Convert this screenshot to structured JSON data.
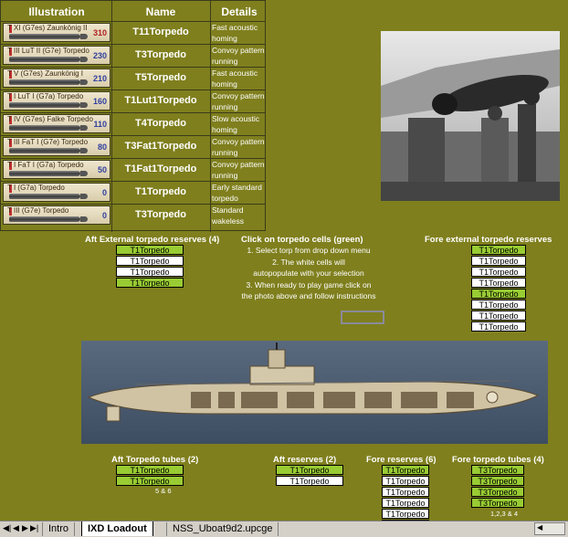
{
  "table": {
    "headers": [
      "Illustration",
      "Name",
      "Details"
    ],
    "rows": [
      {
        "illus_label": "T XI (G7es) Zaunkönig II",
        "illus_num": "310",
        "num_red": true,
        "name": "T11Torpedo",
        "detail": "Fast acoustic homing"
      },
      {
        "illus_label": "T III LuT II (G7e) Torpedo",
        "illus_num": "230",
        "num_red": false,
        "name": "T3Torpedo",
        "detail": "Convoy pattern running"
      },
      {
        "illus_label": "T V (G7es) Zaunkönig I",
        "illus_num": "210",
        "num_red": false,
        "name": "T5Torpedo",
        "detail": "Fast acoustic homing"
      },
      {
        "illus_label": "T I LuT I (G7a) Torpedo",
        "illus_num": "160",
        "num_red": false,
        "name": "T1Lut1Torpedo",
        "detail": "Convoy pattern running"
      },
      {
        "illus_label": "T IV (G7es) Falke Torpedo",
        "illus_num": "110",
        "num_red": false,
        "name": "T4Torpedo",
        "detail": "Slow acoustic homing"
      },
      {
        "illus_label": "T III FaT I (G7e) Torpedo",
        "illus_num": "80",
        "num_red": false,
        "name": "T3Fat1Torpedo",
        "detail": "Convoy pattern running"
      },
      {
        "illus_label": "T I FaT I (G7a) Torpedo",
        "illus_num": "50",
        "num_red": false,
        "name": "T1Fat1Torpedo",
        "detail": "Convoy pattern running"
      },
      {
        "illus_label": "T I (G7a) Torpedo",
        "illus_num": "0",
        "num_red": false,
        "name": "T1Torpedo",
        "detail": "Early standard torpedo"
      },
      {
        "illus_label": "T III (G7e) Torpedo",
        "illus_num": "0",
        "num_red": false,
        "name": "T3Torpedo",
        "detail": "Standard wakeless"
      }
    ]
  },
  "aft_external": {
    "title": "Aft External torpedo reserves (4)",
    "cells": [
      {
        "value": "T1Torpedo",
        "green": true
      },
      {
        "value": "T1Torpedo",
        "green": false
      },
      {
        "value": "T1Torpedo",
        "green": false
      },
      {
        "value": "T1Torpedo",
        "green": true
      }
    ]
  },
  "instructions": {
    "title": "Click on torpedo cells (green)",
    "lines": [
      "1. Select torp from drop down menu",
      "2. The white cells will",
      "autopopulate with your selection",
      "3. When ready to play game click on",
      "the photo above and follow instructions"
    ]
  },
  "fore_external": {
    "title": "Fore external torpedo reserves",
    "cells": [
      {
        "value": "T1Torpedo",
        "green": true
      },
      {
        "value": "T1Torpedo",
        "green": false
      },
      {
        "value": "T1Torpedo",
        "green": false
      },
      {
        "value": "T1Torpedo",
        "green": false
      },
      {
        "value": "T1Torpedo",
        "green": true
      },
      {
        "value": "T1Torpedo",
        "green": false
      },
      {
        "value": "T1Torpedo",
        "green": false
      },
      {
        "value": "T1Torpedo",
        "green": false
      }
    ]
  },
  "aft_tubes": {
    "title": "Aft Torpedo tubes (2)",
    "cells": [
      {
        "value": "T1Torpedo",
        "green": true
      },
      {
        "value": "T1Torpedo",
        "green": true
      }
    ],
    "note": "5 & 6"
  },
  "aft_reserves": {
    "title": "Aft reserves (2)",
    "cells": [
      {
        "value": "T1Torpedo",
        "green": true
      },
      {
        "value": "T1Torpedo",
        "green": false
      }
    ]
  },
  "fore_reserves": {
    "title": "Fore reserves (6)",
    "cells": [
      {
        "value": "T1Torpedo",
        "green": true
      },
      {
        "value": "T1Torpedo",
        "green": false
      },
      {
        "value": "T1Torpedo",
        "green": false
      },
      {
        "value": "T1Torpedo",
        "green": false
      },
      {
        "value": "T1Torpedo",
        "green": false
      },
      {
        "value": "T1Torpedo",
        "green": false
      }
    ]
  },
  "fore_tubes": {
    "title": "Fore torpedo tubes (4)",
    "cells": [
      {
        "value": "T3Torpedo",
        "green": true
      },
      {
        "value": "T3Torpedo",
        "green": true
      },
      {
        "value": "T3Torpedo",
        "green": true
      },
      {
        "value": "T3Torpedo",
        "green": true
      }
    ],
    "note": "1,2,3 & 4"
  },
  "sheet_tabs": {
    "tabs": [
      "Intro",
      "IXD Loadout",
      "NSS_Uboat9d2.upcge"
    ],
    "active": "IXD Loadout"
  }
}
